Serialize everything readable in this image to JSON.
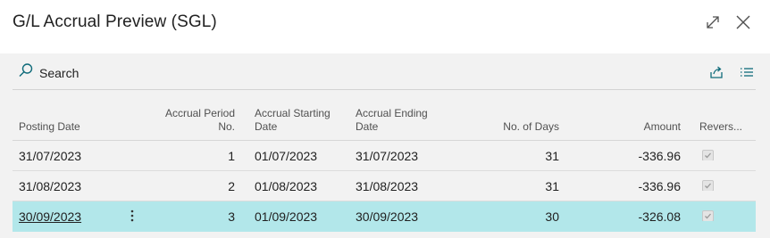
{
  "window": {
    "title": "G/L Accrual Preview (SGL)"
  },
  "toolbar": {
    "search_label": "Search"
  },
  "icons": {
    "expand": "expand-icon",
    "close": "close-icon",
    "share": "share-icon",
    "list_view": "list-view-icon",
    "search": "search-icon",
    "row_menu": "vertical-ellipsis-icon"
  },
  "colors": {
    "accent": "#0f6b7a",
    "selected_row": "#b2e7ea",
    "panel_bg": "#f2f2f2"
  },
  "table": {
    "columns": {
      "posting_date": "Posting Date",
      "period_line1": "Accrual Period",
      "period_line2": "No.",
      "start_line1": "Accrual Starting",
      "start_line2": "Date",
      "end_line1": "Accrual Ending",
      "end_line2": "Date",
      "days": "No. of Days",
      "amount": "Amount",
      "reversed": "Revers..."
    },
    "rows": [
      {
        "posting_date": "31/07/2023",
        "period": "1",
        "start": "01/07/2023",
        "end": "31/07/2023",
        "days": "31",
        "amount": "-336.96",
        "reversed": true
      },
      {
        "posting_date": "31/08/2023",
        "period": "2",
        "start": "01/08/2023",
        "end": "31/08/2023",
        "days": "31",
        "amount": "-336.96",
        "reversed": true
      },
      {
        "posting_date": "30/09/2023",
        "period": "3",
        "start": "01/09/2023",
        "end": "30/09/2023",
        "days": "30",
        "amount": "-326.08",
        "reversed": true
      }
    ],
    "selected_index": 2
  }
}
